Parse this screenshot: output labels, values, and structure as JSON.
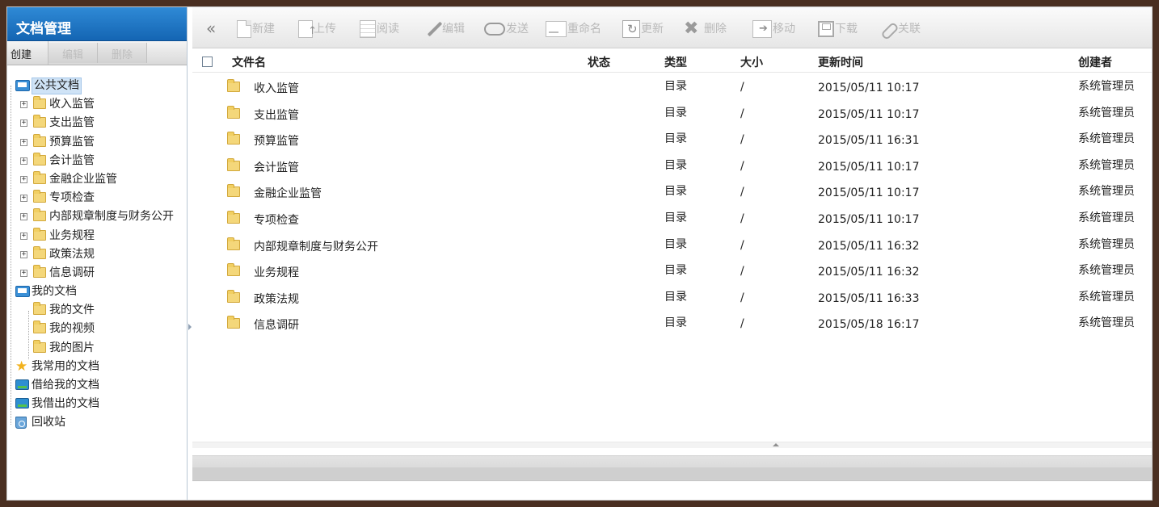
{
  "sidebar": {
    "title": "文档管理",
    "actions": [
      "创建",
      "编辑",
      "删除"
    ],
    "tree": [
      {
        "label": "公共文档",
        "icon": "public-docs-folder-icon",
        "level": 0,
        "expanded": true,
        "selected": true
      },
      {
        "label": "收入监管",
        "icon": "folder-icon",
        "level": 1,
        "has_children": true
      },
      {
        "label": "支出监管",
        "icon": "folder-icon",
        "level": 1,
        "has_children": true
      },
      {
        "label": "预算监管",
        "icon": "folder-icon",
        "level": 1,
        "has_children": true
      },
      {
        "label": "会计监管",
        "icon": "folder-icon",
        "level": 1,
        "has_children": true
      },
      {
        "label": "金融企业监管",
        "icon": "folder-icon",
        "level": 1,
        "has_children": true
      },
      {
        "label": "专项检查",
        "icon": "folder-icon",
        "level": 1,
        "has_children": true
      },
      {
        "label": "内部规章制度与财务公开",
        "icon": "folder-icon",
        "level": 1,
        "has_children": true
      },
      {
        "label": "业务规程",
        "icon": "folder-icon",
        "level": 1,
        "has_children": true
      },
      {
        "label": "政策法规",
        "icon": "folder-icon",
        "level": 1,
        "has_children": true
      },
      {
        "label": "信息调研",
        "icon": "folder-icon",
        "level": 1,
        "has_children": true
      },
      {
        "label": "我的文档",
        "icon": "my-docs-icon",
        "level": 0,
        "expanded": true
      },
      {
        "label": "我的文件",
        "icon": "folder-icon",
        "level": 1
      },
      {
        "label": "我的视频",
        "icon": "folder-icon",
        "level": 1
      },
      {
        "label": "我的图片",
        "icon": "folder-icon",
        "level": 1
      },
      {
        "label": "我常用的文档",
        "icon": "star-icon",
        "level": 0
      },
      {
        "label": "借给我的文档",
        "icon": "borrowed-in-icon",
        "level": 0
      },
      {
        "label": "我借出的文档",
        "icon": "lent-out-icon",
        "level": 0
      },
      {
        "label": "回收站",
        "icon": "recycle-bin-icon",
        "level": 0
      }
    ]
  },
  "toolbar": {
    "collapse_glyph": "«",
    "buttons": [
      {
        "label": "新建",
        "icon": "new-doc-icon"
      },
      {
        "label": "上传",
        "icon": "upload-icon"
      },
      {
        "label": "阅读",
        "icon": "read-icon"
      },
      {
        "label": "编辑",
        "icon": "edit-pen-icon"
      },
      {
        "label": "发送",
        "icon": "send-icon"
      },
      {
        "label": "重命名",
        "icon": "rename-icon"
      },
      {
        "label": "更新",
        "icon": "refresh-icon"
      },
      {
        "label": "删除",
        "icon": "delete-icon"
      },
      {
        "label": "移动",
        "icon": "move-icon"
      },
      {
        "label": "下载",
        "icon": "download-icon"
      },
      {
        "label": "关联",
        "icon": "link-icon"
      }
    ]
  },
  "table": {
    "columns": [
      "文件名",
      "状态",
      "类型",
      "大小",
      "更新时间",
      "创建者"
    ],
    "rows": [
      {
        "name": "收入监管",
        "status": "",
        "type": "目录",
        "size": "/",
        "updated": "2015/05/11 10:17",
        "creator": "系统管理员"
      },
      {
        "name": "支出监管",
        "status": "",
        "type": "目录",
        "size": "/",
        "updated": "2015/05/11 10:17",
        "creator": "系统管理员"
      },
      {
        "name": "预算监管",
        "status": "",
        "type": "目录",
        "size": "/",
        "updated": "2015/05/11 16:31",
        "creator": "系统管理员"
      },
      {
        "name": "会计监管",
        "status": "",
        "type": "目录",
        "size": "/",
        "updated": "2015/05/11 10:17",
        "creator": "系统管理员"
      },
      {
        "name": "金融企业监管",
        "status": "",
        "type": "目录",
        "size": "/",
        "updated": "2015/05/11 10:17",
        "creator": "系统管理员"
      },
      {
        "name": "专项检查",
        "status": "",
        "type": "目录",
        "size": "/",
        "updated": "2015/05/11 10:17",
        "creator": "系统管理员"
      },
      {
        "name": "内部规章制度与财务公开",
        "status": "",
        "type": "目录",
        "size": "/",
        "updated": "2015/05/11 16:32",
        "creator": "系统管理员"
      },
      {
        "name": "业务规程",
        "status": "",
        "type": "目录",
        "size": "/",
        "updated": "2015/05/11 16:32",
        "creator": "系统管理员"
      },
      {
        "name": "政策法规",
        "status": "",
        "type": "目录",
        "size": "/",
        "updated": "2015/05/11 16:33",
        "creator": "系统管理员"
      },
      {
        "name": "信息调研",
        "status": "",
        "type": "目录",
        "size": "/",
        "updated": "2015/05/18 16:17",
        "creator": "系统管理员"
      }
    ]
  }
}
